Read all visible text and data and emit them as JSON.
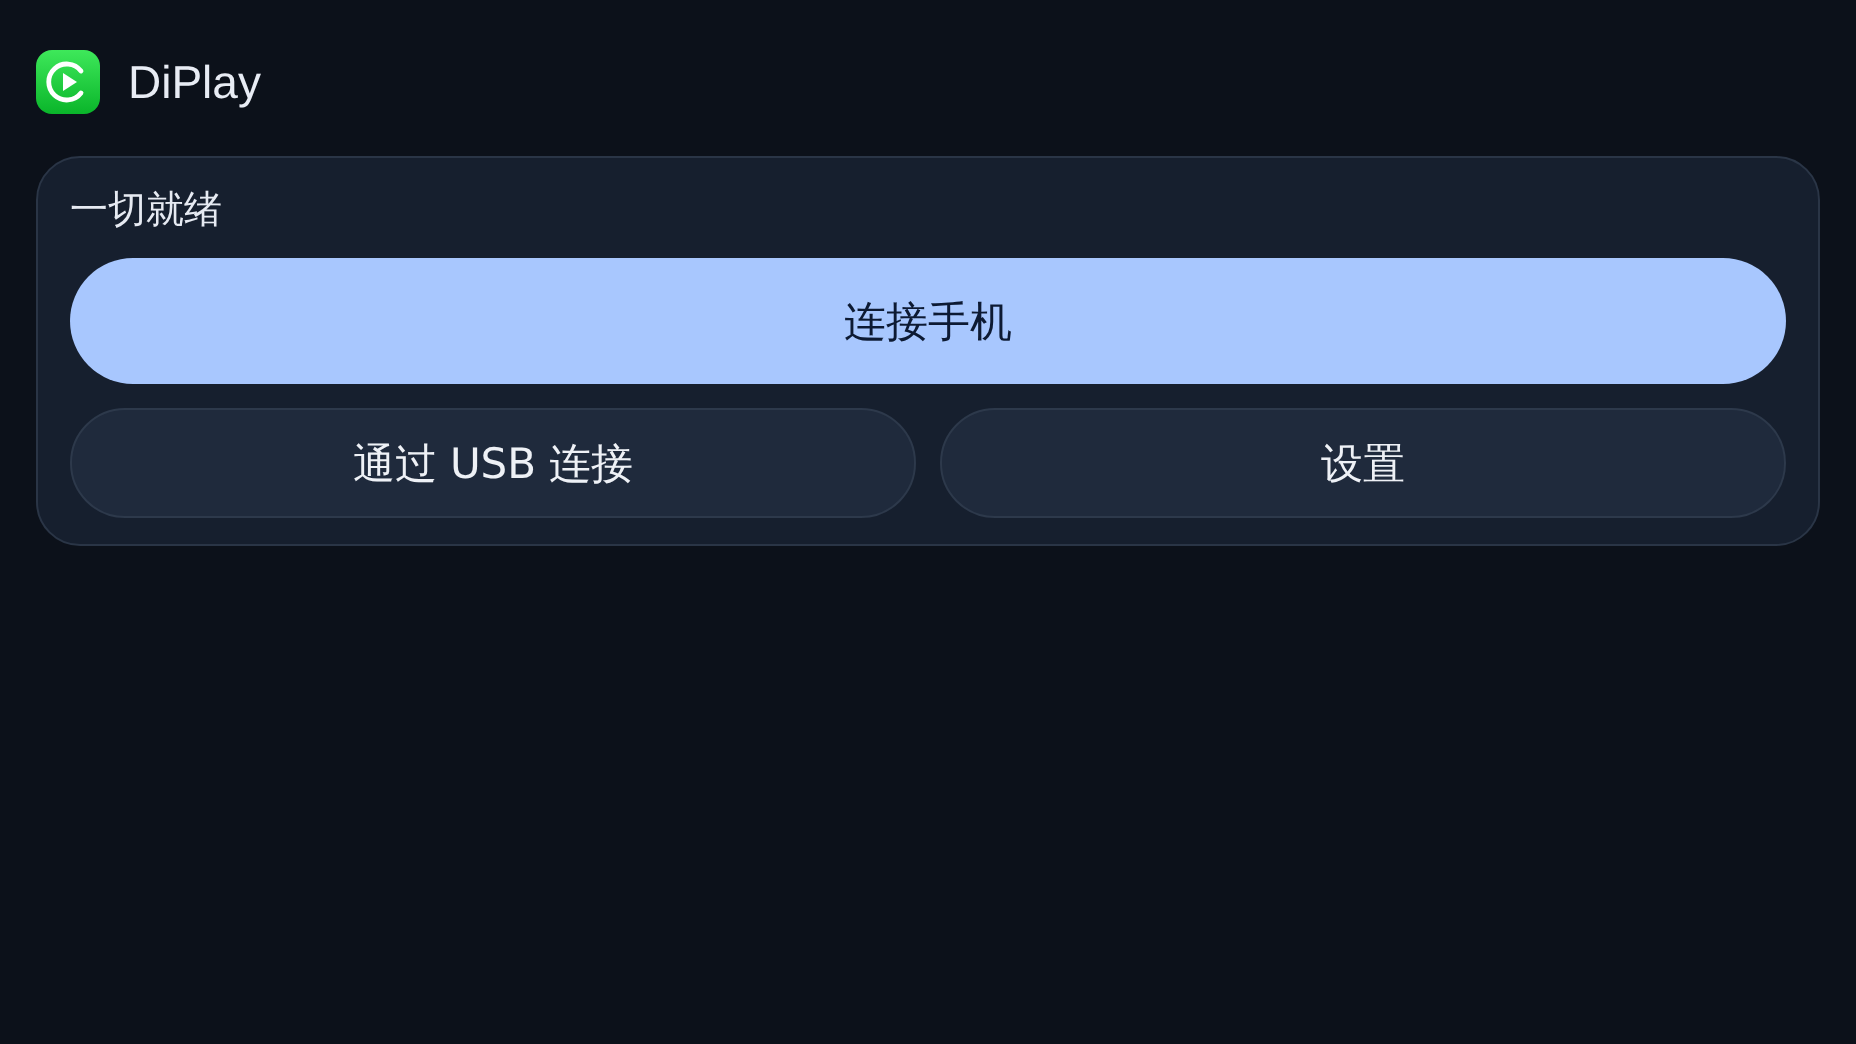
{
  "app": {
    "title": "DiPlay"
  },
  "status": "一切就绪",
  "buttons": [
    {
      "label": "连接手机",
      "kind": "primary"
    },
    {
      "label": "通过 USB 连接",
      "kind": "secondary"
    },
    {
      "label": "设置",
      "kind": "secondary"
    }
  ]
}
